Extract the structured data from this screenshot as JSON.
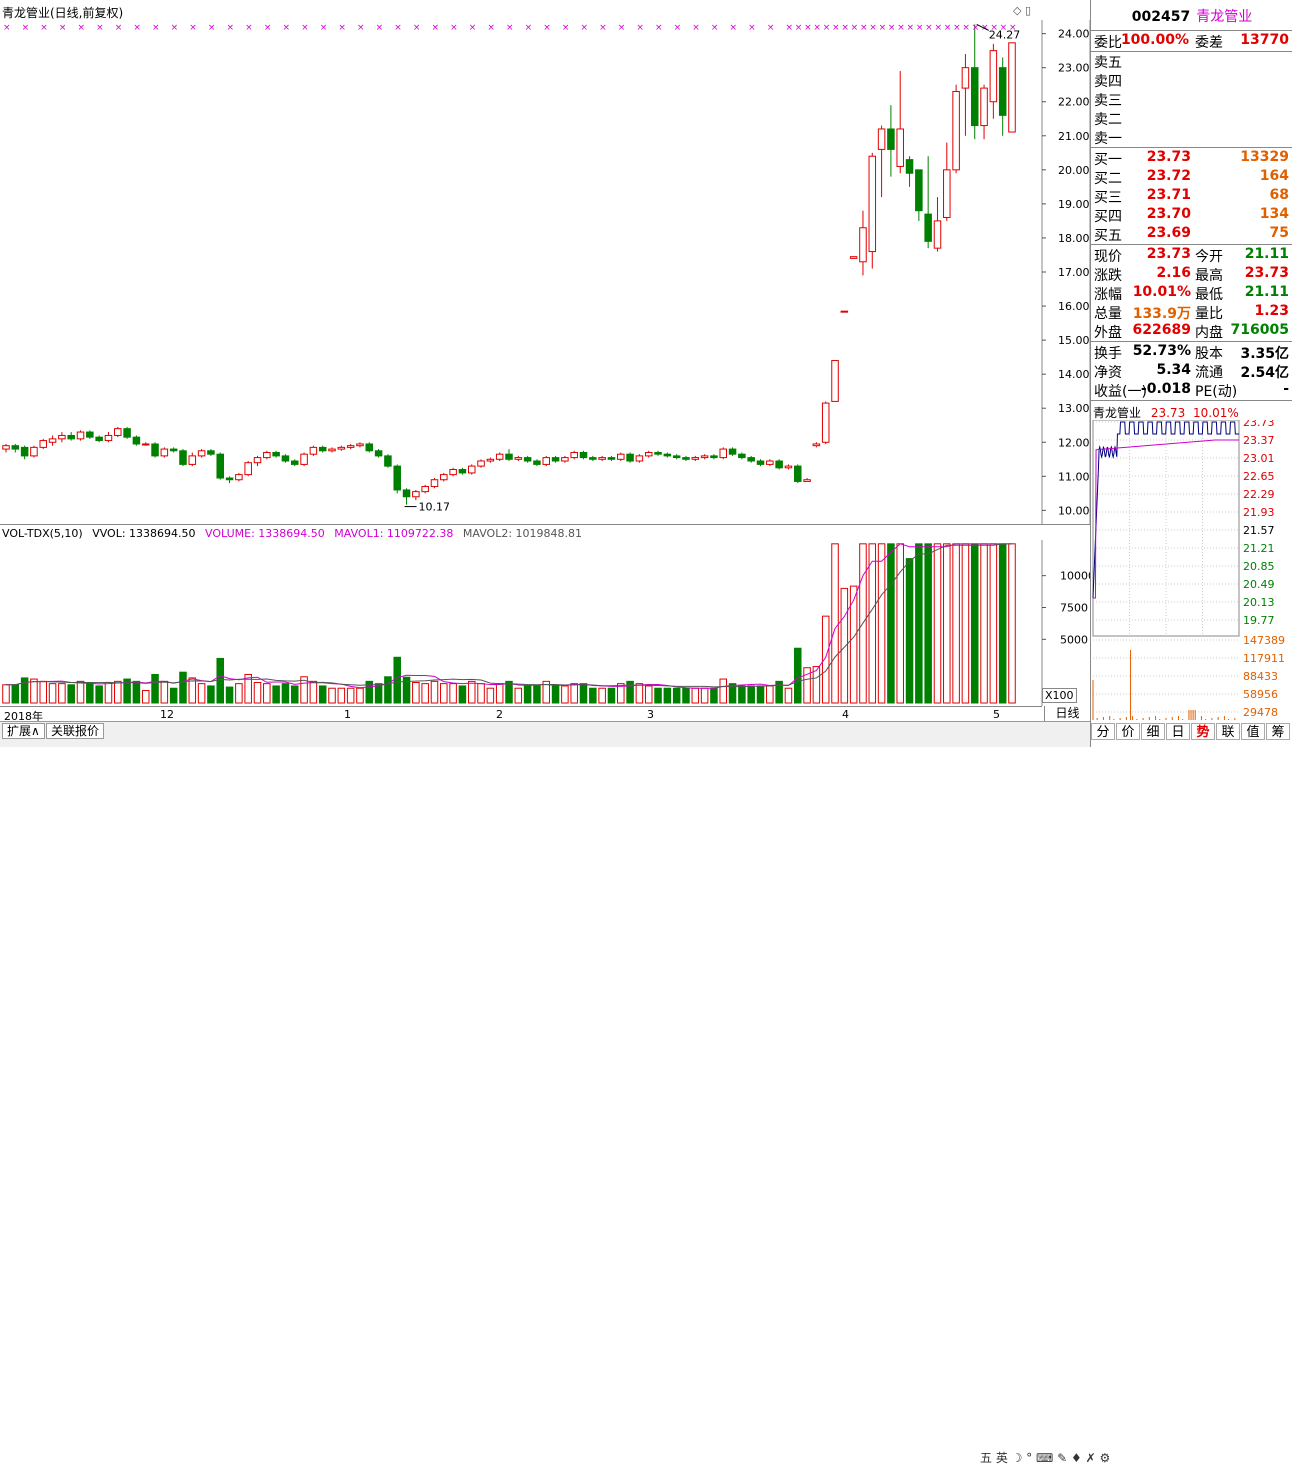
{
  "window": {
    "chart_title": "青龙管业(日线,前复权)",
    "top_icons": "◇ ▯"
  },
  "price_axis": {
    "ticks": [
      "24.00",
      "23.00",
      "22.00",
      "21.00",
      "20.00",
      "19.00",
      "18.00",
      "17.00",
      "16.00",
      "15.00",
      "14.00",
      "13.00",
      "12.00",
      "11.00",
      "10.00"
    ],
    "high_label": "24.27",
    "low_label": "10.17"
  },
  "volume_panel": {
    "indicator": "VOL-TDX(5,10)",
    "vvol": "VVOL: 1338694.50",
    "volume": "VOLUME: 1338694.50",
    "mavol1": "MAVOL1: 1109722.38",
    "mavol2": "MAVOL2: 1019848.81",
    "ticks": [
      "10000",
      "7500",
      "5000"
    ],
    "scale": "X100"
  },
  "time_axis": {
    "labels": [
      "2018年",
      "12",
      "1",
      "2",
      "3",
      "4",
      "5"
    ]
  },
  "period_button": "日线",
  "bottom_tabs": [
    "扩展∧",
    "关联报价"
  ],
  "quote": {
    "code": "002457",
    "name": "青龙管业",
    "weibi_label": "委比",
    "weibi": "100.00%",
    "weicha_label": "委差",
    "weicha": "13770",
    "sells": [
      {
        "label": "卖五"
      },
      {
        "label": "卖四"
      },
      {
        "label": "卖三"
      },
      {
        "label": "卖二"
      },
      {
        "label": "卖一"
      }
    ],
    "buys": [
      {
        "label": "买一",
        "price": "23.73",
        "vol": "13329"
      },
      {
        "label": "买二",
        "price": "23.72",
        "vol": "164"
      },
      {
        "label": "买三",
        "price": "23.71",
        "vol": "68"
      },
      {
        "label": "买四",
        "price": "23.70",
        "vol": "134"
      },
      {
        "label": "买五",
        "price": "23.69",
        "vol": "75"
      }
    ],
    "stats1": [
      {
        "l1": "现价",
        "v1": "23.73",
        "l2": "今开",
        "v2": "21.11",
        "c1": "red",
        "c2": "green"
      },
      {
        "l1": "涨跌",
        "v1": "2.16",
        "l2": "最高",
        "v2": "23.73",
        "c1": "red",
        "c2": "red"
      },
      {
        "l1": "涨幅",
        "v1": "10.01%",
        "l2": "最低",
        "v2": "21.11",
        "c1": "red",
        "c2": "green"
      },
      {
        "l1": "总量",
        "v1": "133.9万",
        "l2": "量比",
        "v2": "1.23",
        "c1": "orange",
        "c2": "red"
      },
      {
        "l1": "外盘",
        "v1": "622689",
        "l2": "内盘",
        "v2": "716005",
        "c1": "red",
        "c2": "green"
      }
    ],
    "stats2": [
      {
        "l1": "换手",
        "v1": "52.73%",
        "l2": "股本",
        "v2": "3.35亿"
      },
      {
        "l1": "净资",
        "v1": "5.34",
        "l2": "流通",
        "v2": "2.54亿"
      },
      {
        "l1": "收益(一)",
        "v1": "-0.018",
        "l2": "PE(动)",
        "v2": "-"
      }
    ]
  },
  "mini_chart": {
    "title_name": "青龙管业",
    "title_price": "23.73",
    "title_pct": "10.01%",
    "price_ticks": [
      "23.73",
      "23.37",
      "23.01",
      "22.65",
      "22.29",
      "21.93",
      "21.57",
      "21.21",
      "20.85",
      "20.49",
      "20.13",
      "19.77"
    ],
    "vol_ticks": [
      "147389",
      "117911",
      "88433",
      "58956",
      "29478"
    ]
  },
  "mini_tabs": [
    "分",
    "价",
    "细",
    "日",
    "势",
    "联",
    "值",
    "筹"
  ],
  "mini_tab_active": "势",
  "taskbar": "五 英 ☽ ° ⌨ ✎ ♦ ✗ ⚙",
  "chart_data": {
    "type": "candlestick",
    "title": "青龙管业(日线,前复权)",
    "ylim": [
      9.6,
      24.4
    ],
    "marked_high": 24.27,
    "marked_low": 10.17,
    "x_labels": [
      "2018年",
      "12",
      "1",
      "2",
      "3",
      "4",
      "5"
    ],
    "candles": [
      [
        11.8,
        11.9,
        11.7,
        11.95
      ],
      [
        11.9,
        11.8,
        11.7,
        11.95
      ],
      [
        11.85,
        11.6,
        11.5,
        11.9
      ],
      [
        11.6,
        11.85,
        11.55,
        11.9
      ],
      [
        11.85,
        12.05,
        11.8,
        12.1
      ],
      [
        12.0,
        12.1,
        11.9,
        12.2
      ],
      [
        12.1,
        12.2,
        12.0,
        12.3
      ],
      [
        12.2,
        12.1,
        12.05,
        12.3
      ],
      [
        12.1,
        12.3,
        12.05,
        12.35
      ],
      [
        12.3,
        12.15,
        12.1,
        12.35
      ],
      [
        12.15,
        12.05,
        12.0,
        12.2
      ],
      [
        12.05,
        12.2,
        12.0,
        12.3
      ],
      [
        12.2,
        12.4,
        12.15,
        12.45
      ],
      [
        12.4,
        12.15,
        12.1,
        12.45
      ],
      [
        12.15,
        11.95,
        11.9,
        12.2
      ],
      [
        11.95,
        11.95,
        11.9,
        12.0
      ],
      [
        11.95,
        11.6,
        11.55,
        12.0
      ],
      [
        11.6,
        11.8,
        11.55,
        11.85
      ],
      [
        11.8,
        11.75,
        11.7,
        11.85
      ],
      [
        11.75,
        11.35,
        11.3,
        11.8
      ],
      [
        11.35,
        11.6,
        11.3,
        11.7
      ],
      [
        11.6,
        11.75,
        11.55,
        11.8
      ],
      [
        11.75,
        11.65,
        11.6,
        11.8
      ],
      [
        11.65,
        10.95,
        10.9,
        11.7
      ],
      [
        10.95,
        10.9,
        10.8,
        11.0
      ],
      [
        10.9,
        11.05,
        10.85,
        11.1
      ],
      [
        11.05,
        11.4,
        11.0,
        11.45
      ],
      [
        11.4,
        11.55,
        11.3,
        11.6
      ],
      [
        11.55,
        11.7,
        11.5,
        11.75
      ],
      [
        11.7,
        11.6,
        11.55,
        11.75
      ],
      [
        11.6,
        11.45,
        11.4,
        11.65
      ],
      [
        11.45,
        11.35,
        11.3,
        11.5
      ],
      [
        11.35,
        11.65,
        11.3,
        11.7
      ],
      [
        11.65,
        11.85,
        11.6,
        11.9
      ],
      [
        11.85,
        11.75,
        11.7,
        11.9
      ],
      [
        11.75,
        11.8,
        11.7,
        11.85
      ],
      [
        11.8,
        11.85,
        11.75,
        11.9
      ],
      [
        11.85,
        11.9,
        11.8,
        11.95
      ],
      [
        11.9,
        11.95,
        11.85,
        12.0
      ],
      [
        11.95,
        11.75,
        11.7,
        12.0
      ],
      [
        11.75,
        11.6,
        11.55,
        11.8
      ],
      [
        11.6,
        11.3,
        11.25,
        11.65
      ],
      [
        11.3,
        10.6,
        10.5,
        11.35
      ],
      [
        10.6,
        10.4,
        10.17,
        10.65
      ],
      [
        10.4,
        10.55,
        10.3,
        10.6
      ],
      [
        10.55,
        10.7,
        10.5,
        10.75
      ],
      [
        10.7,
        10.9,
        10.65,
        10.95
      ],
      [
        10.9,
        11.05,
        10.85,
        11.1
      ],
      [
        11.05,
        11.2,
        11.0,
        11.25
      ],
      [
        11.2,
        11.1,
        11.05,
        11.25
      ],
      [
        11.1,
        11.3,
        11.05,
        11.35
      ],
      [
        11.3,
        11.45,
        11.25,
        11.5
      ],
      [
        11.45,
        11.5,
        11.4,
        11.55
      ],
      [
        11.5,
        11.65,
        11.45,
        11.7
      ],
      [
        11.65,
        11.5,
        11.45,
        11.8
      ],
      [
        11.5,
        11.55,
        11.45,
        11.6
      ],
      [
        11.55,
        11.45,
        11.4,
        11.6
      ],
      [
        11.45,
        11.35,
        11.3,
        11.5
      ],
      [
        11.35,
        11.55,
        11.3,
        11.6
      ],
      [
        11.55,
        11.45,
        11.4,
        11.6
      ],
      [
        11.45,
        11.55,
        11.4,
        11.6
      ],
      [
        11.55,
        11.7,
        11.5,
        11.75
      ],
      [
        11.7,
        11.55,
        11.5,
        11.75
      ],
      [
        11.55,
        11.5,
        11.45,
        11.6
      ],
      [
        11.5,
        11.55,
        11.45,
        11.6
      ],
      [
        11.55,
        11.5,
        11.45,
        11.6
      ],
      [
        11.5,
        11.65,
        11.45,
        11.7
      ],
      [
        11.65,
        11.45,
        11.4,
        11.7
      ],
      [
        11.45,
        11.6,
        11.4,
        11.65
      ],
      [
        11.6,
        11.7,
        11.55,
        11.75
      ],
      [
        11.7,
        11.65,
        11.6,
        11.75
      ],
      [
        11.65,
        11.6,
        11.55,
        11.7
      ],
      [
        11.6,
        11.55,
        11.5,
        11.65
      ],
      [
        11.55,
        11.5,
        11.45,
        11.6
      ],
      [
        11.5,
        11.55,
        11.45,
        11.6
      ],
      [
        11.55,
        11.6,
        11.5,
        11.65
      ],
      [
        11.6,
        11.55,
        11.5,
        11.65
      ],
      [
        11.55,
        11.8,
        11.5,
        11.85
      ],
      [
        11.8,
        11.65,
        11.6,
        11.85
      ],
      [
        11.65,
        11.55,
        11.5,
        11.7
      ],
      [
        11.55,
        11.45,
        11.4,
        11.6
      ],
      [
        11.45,
        11.35,
        11.3,
        11.5
      ],
      [
        11.35,
        11.45,
        11.3,
        11.5
      ],
      [
        11.45,
        11.25,
        11.2,
        11.5
      ],
      [
        11.25,
        11.3,
        11.2,
        11.35
      ],
      [
        11.3,
        10.85,
        10.8,
        11.35
      ],
      [
        10.85,
        10.9,
        10.85,
        10.95
      ],
      [
        11.9,
        11.95,
        11.85,
        12.0
      ],
      [
        12.0,
        13.15,
        11.95,
        13.2
      ],
      [
        13.2,
        14.4,
        13.2,
        14.4
      ],
      [
        15.85,
        15.85,
        15.85,
        15.85
      ],
      [
        17.4,
        17.45,
        17.4,
        17.45
      ],
      [
        17.3,
        18.3,
        16.9,
        18.8
      ],
      [
        17.6,
        20.4,
        17.1,
        20.5
      ],
      [
        20.6,
        21.2,
        19.2,
        21.3
      ],
      [
        21.2,
        20.6,
        19.8,
        21.9
      ],
      [
        20.1,
        21.2,
        19.9,
        22.9
      ],
      [
        20.3,
        19.9,
        19.5,
        20.4
      ],
      [
        20.0,
        18.8,
        18.5,
        20.0
      ],
      [
        18.7,
        17.9,
        17.7,
        20.4
      ],
      [
        17.7,
        18.5,
        17.6,
        19.2
      ],
      [
        18.6,
        20.0,
        18.5,
        20.8
      ],
      [
        20.0,
        22.3,
        19.9,
        22.5
      ],
      [
        22.4,
        23.0,
        21.0,
        23.4
      ],
      [
        23.0,
        21.3,
        20.9,
        24.27
      ],
      [
        21.3,
        22.4,
        20.9,
        22.5
      ],
      [
        22.0,
        23.5,
        21.5,
        23.7
      ],
      [
        23.0,
        21.6,
        21.0,
        23.3
      ],
      [
        21.11,
        23.73,
        21.11,
        23.73
      ]
    ],
    "volume_axis_ticks": [
      10000,
      7500,
      5000
    ],
    "volume_unit": "X100"
  }
}
